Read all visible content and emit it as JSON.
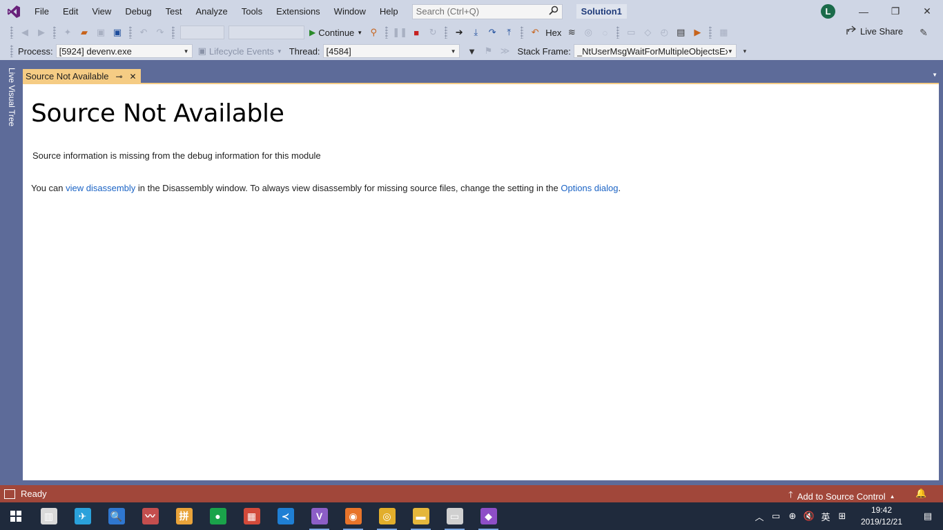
{
  "menu": {
    "items": [
      "File",
      "Edit",
      "View",
      "Debug",
      "Test",
      "Analyze",
      "Tools",
      "Extensions",
      "Window",
      "Help"
    ]
  },
  "search": {
    "placeholder": "Search (Ctrl+Q)"
  },
  "solution": {
    "name": "Solution1"
  },
  "account": {
    "initial": "L"
  },
  "toolbar": {
    "continue_label": "Continue",
    "hex_label": "Hex",
    "live_share_label": "Live Share"
  },
  "debug_location": {
    "process_label": "Process:",
    "process_value": "[5924] devenv.exe",
    "lifecycle_label": "Lifecycle Events",
    "thread_label": "Thread:",
    "thread_value": "[4584]",
    "stack_frame_label": "Stack Frame:",
    "stack_frame_value": "_NtUserMsgWaitForMultipleObjectsEx"
  },
  "side_panel": {
    "label": "Live Visual Tree"
  },
  "document_tab": {
    "title": "Source Not Available"
  },
  "content": {
    "heading": "Source Not Available",
    "message": "Source information is missing from the debug information for this module",
    "line_prefix": "You can ",
    "link_disassembly": "view disassembly",
    "line_middle": " in the Disassembly window. To always view disassembly for missing source files, change the setting in the ",
    "link_options": "Options dialog",
    "line_suffix": "."
  },
  "status": {
    "text": "Ready",
    "source_control": "Add to Source Control"
  },
  "taskbar": {
    "apps": [
      {
        "icon": "book-reader-icon",
        "color": "#d9d9d9"
      },
      {
        "icon": "telegram-icon",
        "color": "#2aa1db"
      },
      {
        "icon": "search-app-icon",
        "color": "#2f77d0"
      },
      {
        "icon": "chart-app-icon",
        "color": "#c44e4e"
      },
      {
        "icon": "pinyin-app-icon",
        "color": "#e9a33a"
      },
      {
        "icon": "green-circle-app-icon",
        "color": "#1aa34a"
      },
      {
        "icon": "calendar-app-icon",
        "color": "#d24a3a"
      },
      {
        "icon": "vscode-icon",
        "color": "#1f7fd4"
      },
      {
        "icon": "visual-studio-icon",
        "color": "#8c5ec7"
      },
      {
        "icon": "firefox-icon",
        "color": "#e8742a"
      },
      {
        "icon": "chrome-icon",
        "color": "#e2ae2b"
      },
      {
        "icon": "file-explorer-icon",
        "color": "#e5b73c"
      },
      {
        "icon": "remote-desktop-icon",
        "color": "#d0d0d0"
      },
      {
        "icon": "visual-studio-alt-icon",
        "color": "#8e4ec7"
      }
    ],
    "ime_label": "英",
    "time": "19:42",
    "date": "2019/12/21"
  }
}
